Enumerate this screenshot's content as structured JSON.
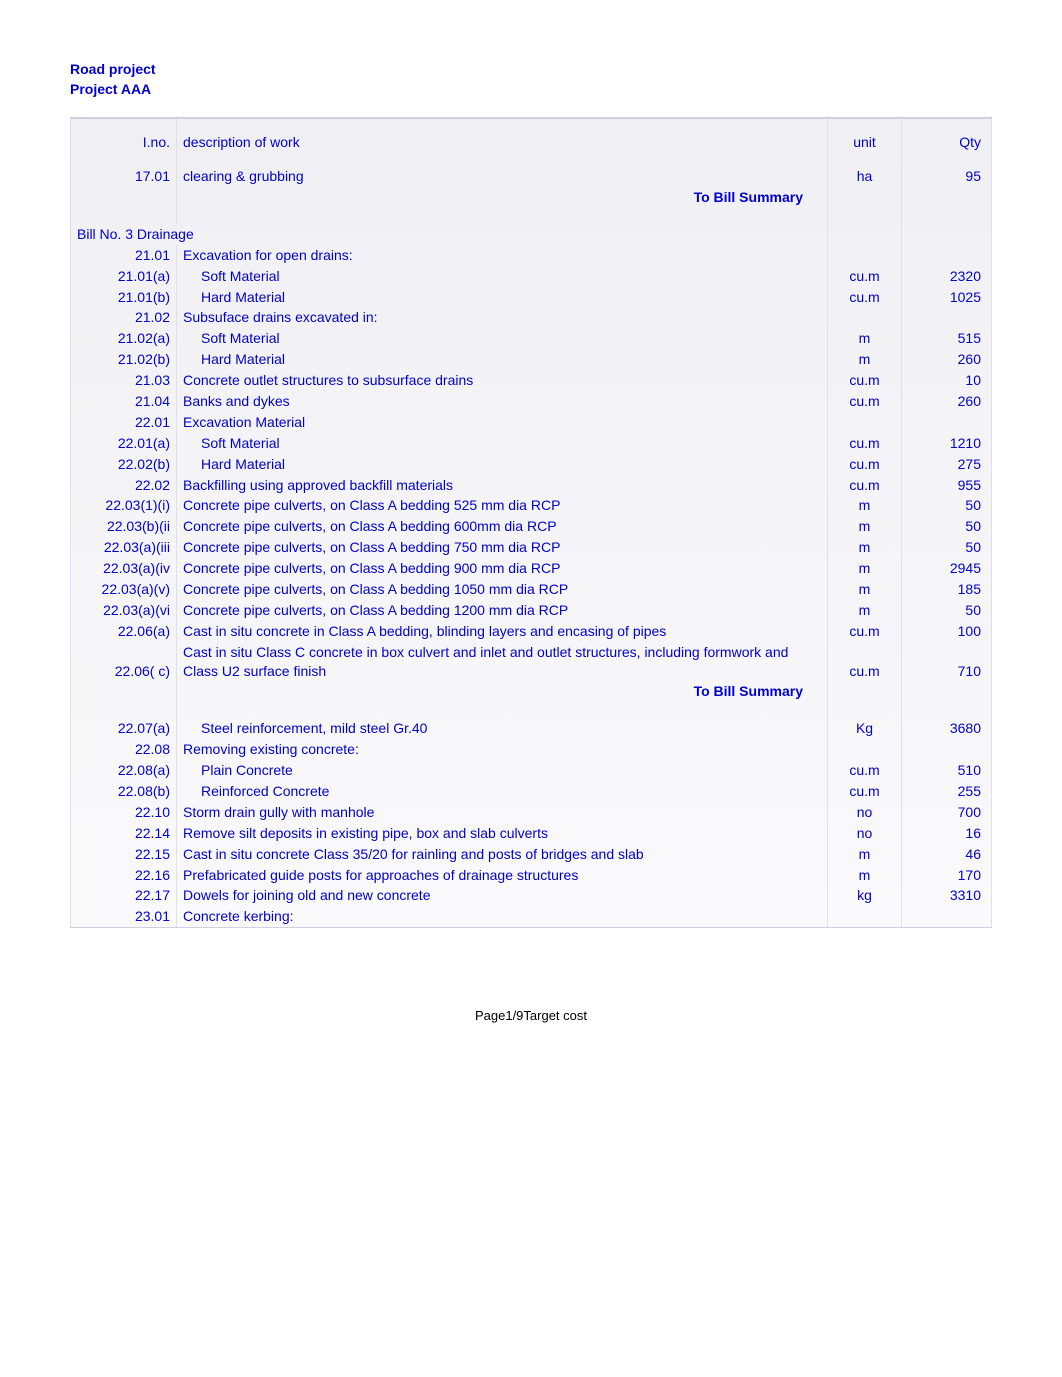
{
  "header": {
    "line1": "Road project",
    "line2": "Project AAA"
  },
  "columns": {
    "ino": "I.no.",
    "desc": "description of work",
    "unit": "unit",
    "qty": "Qty"
  },
  "rows": [
    {
      "ino": "17.01",
      "desc": "clearing & grubbing",
      "unit": "ha",
      "qty": "95",
      "indent": false
    },
    {
      "summary": "To Bill Summary"
    },
    {
      "spacer": true
    },
    {
      "ino": "",
      "desc": "Bill No. 3 Drainage",
      "unit": "",
      "qty": "",
      "fullrow": true
    },
    {
      "ino": "21.01",
      "desc": "Excavation for open drains:",
      "unit": "",
      "qty": ""
    },
    {
      "ino": "21.01(a)",
      "desc": "Soft Material",
      "unit": "cu.m",
      "qty": "2320",
      "indent": true
    },
    {
      "ino": "21.01(b)",
      "desc": "Hard Material",
      "unit": "cu.m",
      "qty": "1025",
      "indent": true
    },
    {
      "ino": "21.02",
      "desc": "Subsuface drains excavated in:",
      "unit": "",
      "qty": ""
    },
    {
      "ino": "21.02(a)",
      "desc": "Soft Material",
      "unit": "m",
      "qty": "515",
      "indent": true
    },
    {
      "ino": "21.02(b)",
      "desc": "Hard Material",
      "unit": "m",
      "qty": "260",
      "indent": true
    },
    {
      "ino": "21.03",
      "desc": "Concrete outlet structures to subsurface drains",
      "unit": "cu.m",
      "qty": "10"
    },
    {
      "ino": "21.04",
      "desc": "Banks and dykes",
      "unit": "cu.m",
      "qty": "260"
    },
    {
      "ino": "22.01",
      "desc": "Excavation Material",
      "unit": "",
      "qty": ""
    },
    {
      "ino": "22.01(a)",
      "desc": "Soft Material",
      "unit": "cu.m",
      "qty": "1210",
      "indent": true
    },
    {
      "ino": "22.02(b)",
      "desc": "Hard Material",
      "unit": "cu.m",
      "qty": "275",
      "indent": true
    },
    {
      "ino": "22.02",
      "desc": "Backfilling using approved backfill materials",
      "unit": "cu.m",
      "qty": "955"
    },
    {
      "ino": "22.03(1)(i)",
      "desc": "Concrete pipe culverts, on Class A bedding 525 mm dia RCP",
      "unit": "m",
      "qty": "50"
    },
    {
      "ino": "22.03(b)(ii",
      "desc": "Concrete pipe culverts, on Class A bedding 600mm dia RCP",
      "unit": "m",
      "qty": "50"
    },
    {
      "ino": "22.03(a)(iii",
      "desc": "Concrete pipe culverts, on Class A bedding 750 mm dia RCP",
      "unit": "m",
      "qty": "50"
    },
    {
      "ino": "22.03(a)(iv",
      "desc": "Concrete pipe culverts, on Class A bedding 900 mm dia RCP",
      "unit": "m",
      "qty": "2945"
    },
    {
      "ino": "22.03(a)(v)",
      "desc": "Concrete pipe culverts, on Class A bedding 1050 mm dia RCP",
      "unit": "m",
      "qty": "185"
    },
    {
      "ino": "22.03(a)(vi",
      "desc": "Concrete pipe culverts, on Class A bedding 1200 mm dia RCP",
      "unit": "m",
      "qty": "50"
    },
    {
      "ino": "22.06(a)",
      "desc": "Cast in situ concrete in Class A bedding, blinding layers and encasing of pipes",
      "unit": "cu.m",
      "qty": "100"
    },
    {
      "ino": "22.06( c)",
      "desc": "Cast in situ Class C concrete in box culvert and inlet and outlet structures, including formwork and Class U2 surface finish",
      "unit": "cu.m",
      "qty": "710"
    },
    {
      "summary": "To Bill Summary"
    },
    {
      "spacer": true
    },
    {
      "ino": "22.07(a)",
      "desc": "Steel reinforcement, mild steel Gr.40",
      "unit": "Kg",
      "qty": "3680",
      "indent": true
    },
    {
      "ino": "22.08",
      "desc": "Removing existing concrete:",
      "unit": "",
      "qty": ""
    },
    {
      "ino": "22.08(a)",
      "desc": "Plain Concrete",
      "unit": "cu.m",
      "qty": "510",
      "indent": true
    },
    {
      "ino": "22.08(b)",
      "desc": "Reinforced Concrete",
      "unit": "cu.m",
      "qty": "255",
      "indent": true
    },
    {
      "ino": "22.10",
      "desc": "Storm drain gully with manhole",
      "unit": "no",
      "qty": "700"
    },
    {
      "ino": "22.14",
      "desc": "Remove silt deposits in existing pipe, box and slab culverts",
      "unit": "no",
      "qty": "16"
    },
    {
      "ino": "22.15",
      "desc": "Cast in situ concrete Class 35/20 for rainling and posts of bridges and slab",
      "unit": "m",
      "qty": "46"
    },
    {
      "ino": "22.16",
      "desc": "Prefabricated guide posts for approaches of drainage structures",
      "unit": "m",
      "qty": "170"
    },
    {
      "ino": "22.17",
      "desc": "Dowels for joining old and new concrete",
      "unit": "kg",
      "qty": "3310"
    },
    {
      "ino": "23.01",
      "desc": "Concrete kerbing:",
      "unit": "",
      "qty": ""
    }
  ],
  "footer": "Page1/9Target cost"
}
